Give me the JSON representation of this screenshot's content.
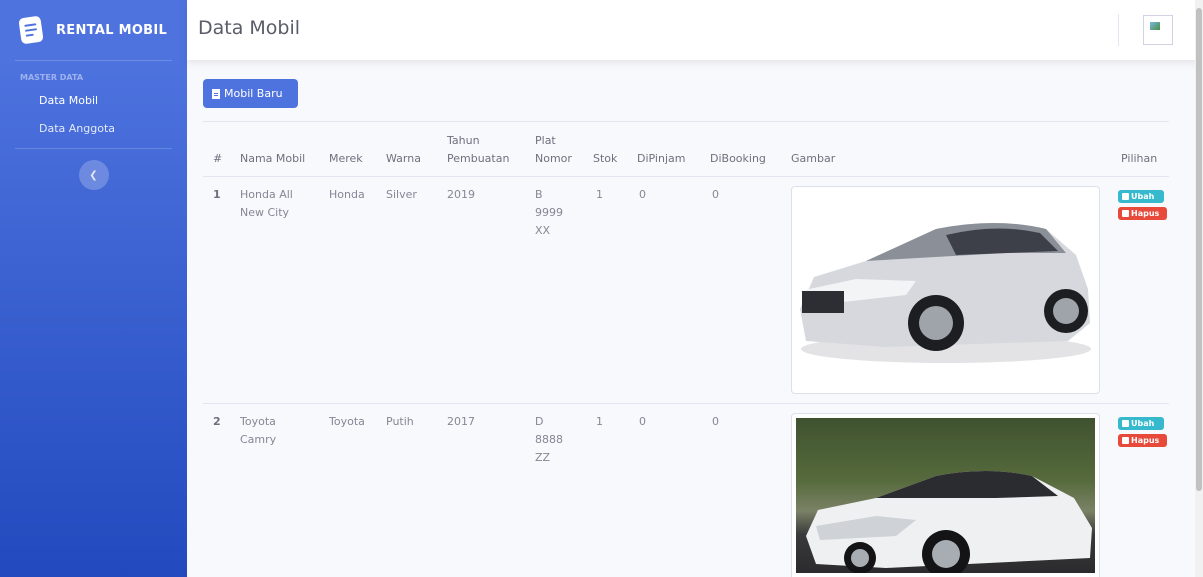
{
  "sidebar": {
    "brand": "RENTAL MOBIL",
    "heading": "MASTER DATA",
    "items": [
      {
        "label": "Data Mobil"
      },
      {
        "label": "Data Anggota"
      }
    ],
    "toggle_icon": "chevron-left"
  },
  "topbar": {
    "title": "Data Mobil"
  },
  "toolbar": {
    "new_label": "Mobil Baru"
  },
  "table": {
    "headers": {
      "no": "#",
      "nama": "Nama Mobil",
      "merek": "Merek",
      "warna": "Warna",
      "tahun_1": "Tahun",
      "tahun_2": "Pembuatan",
      "plat_1": "Plat",
      "plat_2": "Nomor",
      "stok": "Stok",
      "dipinjam": "DiPinjam",
      "dibooking": "DiBooking",
      "gambar": "Gambar",
      "pilihan": "Pilihan"
    },
    "rows": [
      {
        "no": "1",
        "nama_1": "Honda All",
        "nama_2": "New City",
        "merek": "Honda",
        "warna": "Silver",
        "tahun": "2019",
        "plat_1": "B",
        "plat_2": "9999",
        "plat_3": "XX",
        "stok": "1",
        "dipinjam": "0",
        "dibooking": "0",
        "gambar": "silver Honda City sedan",
        "edit": "Ubah",
        "delete": "Hapus"
      },
      {
        "no": "2",
        "nama_1": "Toyota",
        "nama_2": "Camry",
        "merek": "Toyota",
        "warna": "Putih",
        "tahun": "2017",
        "plat_1": "D",
        "plat_2": "8888",
        "plat_3": "ZZ",
        "stok": "1",
        "dipinjam": "0",
        "dibooking": "0",
        "gambar": "white Toyota Camry sedan",
        "edit": "Ubah",
        "delete": "Hapus"
      }
    ]
  },
  "colors": {
    "primary": "#4e73df",
    "info": "#36b9cc",
    "danger": "#e74a3b"
  }
}
